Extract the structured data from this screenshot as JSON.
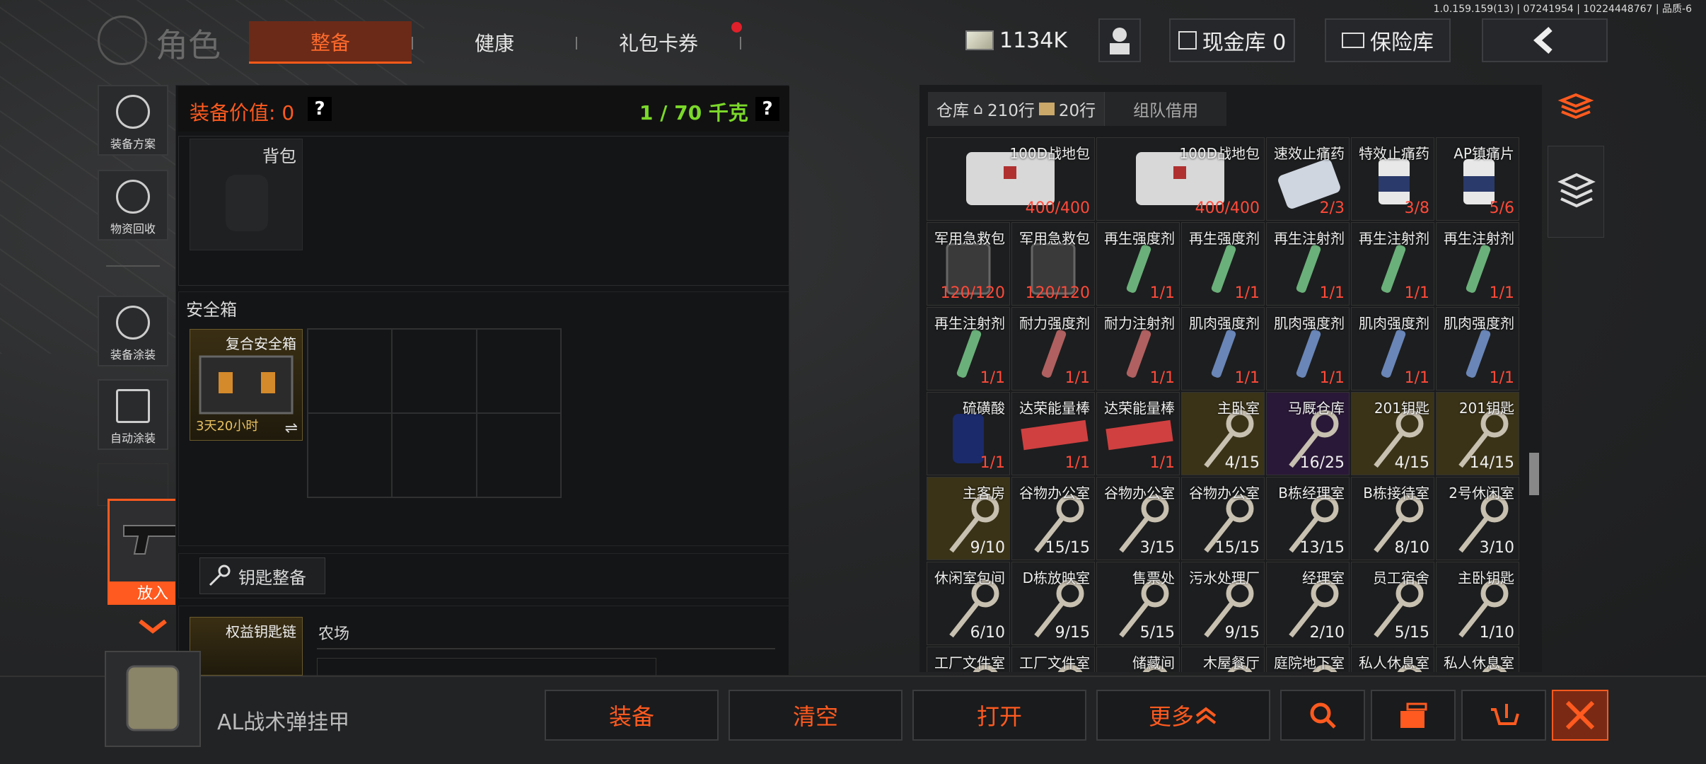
{
  "version": "1.0.159.159(13) | 07241954 | 10224448767 | 品质-6",
  "header": {
    "title": "角色",
    "tabs": [
      {
        "label": "整备",
        "active": true
      },
      {
        "label": "健康",
        "active": false
      },
      {
        "label": "礼包卡券",
        "active": false
      }
    ],
    "money": "1134K",
    "cash_vault": "现金库 0",
    "insurance": "保险库"
  },
  "sidebar": {
    "items": [
      {
        "label": "装备方案",
        "icon": "helmet-icon"
      },
      {
        "label": "物资回收",
        "icon": "recycle-icon"
      },
      {
        "label": "装备涂装",
        "icon": "paint-helmet-icon"
      },
      {
        "label": "自动涂装",
        "icon": "auto-paint-icon"
      }
    ],
    "drag_item_label": "放入"
  },
  "equip": {
    "value_label": "装备价值: 0",
    "weight": "1 / 70 千克",
    "help": "?",
    "backpack_label": "背包",
    "safebox_title": "安全箱",
    "safebox_item": "复合安全箱",
    "safebox_time": "3天20小时",
    "key_organize": "钥匙整备",
    "keychain_item": "权益钥匙链",
    "farm_label": "农场"
  },
  "storage": {
    "tab_warehouse": "仓库",
    "rows_home": "210行",
    "rows_bag": "20行",
    "tab_team": "组队借用",
    "rows": [
      [
        {
          "name": "100D战地包",
          "count": "400/400",
          "color": "dark",
          "kind": "bag"
        },
        {
          "name": "100D战地包",
          "count": "400/400",
          "color": "dark",
          "kind": "bag"
        },
        {
          "name": "速效止痛药",
          "count": "2/3",
          "color": "dark",
          "kind": "pills"
        },
        {
          "name": "特效止痛药",
          "count": "3/8",
          "color": "dark",
          "kind": "bottle"
        },
        {
          "name": "AP镇痛片",
          "count": "5/6",
          "color": "dark",
          "kind": "bottle"
        }
      ],
      [
        {
          "name": "军用急救包",
          "count": "120/120",
          "color": "dark",
          "kind": "kit"
        },
        {
          "name": "军用急救包",
          "count": "120/120",
          "color": "dark",
          "kind": "kit"
        },
        {
          "name": "再生强度剂",
          "count": "1/1",
          "color": "dark",
          "kind": "syr-g"
        },
        {
          "name": "再生强度剂",
          "count": "1/1",
          "color": "dark",
          "kind": "syr-g"
        },
        {
          "name": "再生注射剂",
          "count": "1/1",
          "color": "dark",
          "kind": "syr-g"
        },
        {
          "name": "再生注射剂",
          "count": "1/1",
          "color": "dark",
          "kind": "syr-g"
        },
        {
          "name": "再生注射剂",
          "count": "1/1",
          "color": "dark",
          "kind": "syr-g"
        }
      ],
      [
        {
          "name": "再生注射剂",
          "count": "1/1",
          "color": "dark",
          "kind": "syr-g"
        },
        {
          "name": "耐力强度剂",
          "count": "1/1",
          "color": "dark",
          "kind": "syr-r"
        },
        {
          "name": "耐力注射剂",
          "count": "1/1",
          "color": "dark",
          "kind": "syr-r"
        },
        {
          "name": "肌肉强度剂",
          "count": "1/1",
          "color": "dark",
          "kind": "syr-b"
        },
        {
          "name": "肌肉强度剂",
          "count": "1/1",
          "color": "dark",
          "kind": "syr-b"
        },
        {
          "name": "肌肉强度剂",
          "count": "1/1",
          "color": "dark",
          "kind": "syr-b"
        },
        {
          "name": "肌肉强度剂",
          "count": "1/1",
          "color": "dark",
          "kind": "syr-b"
        }
      ],
      [
        {
          "name": "硫磺酸",
          "count": "1/1",
          "color": "dark",
          "kind": "can"
        },
        {
          "name": "达荣能量棒",
          "count": "1/1",
          "color": "dark",
          "kind": "bar"
        },
        {
          "name": "达荣能量棒",
          "count": "1/1",
          "color": "dark",
          "kind": "bar"
        },
        {
          "name": "主卧室",
          "count": "4/15",
          "color": "gold",
          "kind": "key"
        },
        {
          "name": "马厩仓库",
          "count": "16/25",
          "color": "purple",
          "kind": "key"
        },
        {
          "name": "201钥匙",
          "count": "4/15",
          "color": "gold",
          "kind": "key"
        },
        {
          "name": "201钥匙",
          "count": "14/15",
          "color": "gold",
          "kind": "key"
        }
      ],
      [
        {
          "name": "主客房",
          "count": "9/10",
          "color": "gold",
          "kind": "key"
        },
        {
          "name": "谷物办公室",
          "count": "15/15",
          "color": "dark",
          "kind": "key"
        },
        {
          "name": "谷物办公室",
          "count": "3/15",
          "color": "dark",
          "kind": "key"
        },
        {
          "name": "谷物办公室",
          "count": "15/15",
          "color": "dark",
          "kind": "key"
        },
        {
          "name": "B栋经理室",
          "count": "13/15",
          "color": "dark",
          "kind": "key"
        },
        {
          "name": "B栋接待室",
          "count": "8/10",
          "color": "dark",
          "kind": "key"
        },
        {
          "name": "2号休闲室",
          "count": "3/10",
          "color": "dark",
          "kind": "key"
        }
      ],
      [
        {
          "name": "休闲室包间",
          "count": "6/10",
          "color": "dark",
          "kind": "key"
        },
        {
          "name": "D栋放映室",
          "count": "9/15",
          "color": "dark",
          "kind": "key"
        },
        {
          "name": "售票处",
          "count": "5/15",
          "color": "dark",
          "kind": "key"
        },
        {
          "name": "污水处理厂",
          "count": "9/15",
          "color": "dark",
          "kind": "key"
        },
        {
          "name": "经理室",
          "count": "2/10",
          "color": "dark",
          "kind": "key"
        },
        {
          "name": "员工宿舍",
          "count": "5/15",
          "color": "dark",
          "kind": "key"
        },
        {
          "name": "主卧钥匙",
          "count": "1/10",
          "color": "dark",
          "kind": "key"
        }
      ],
      [
        {
          "name": "工厂文件室",
          "count": "",
          "color": "dark",
          "kind": "key"
        },
        {
          "name": "工厂文件室",
          "count": "",
          "color": "dark",
          "kind": "key"
        },
        {
          "name": "储藏间",
          "count": "",
          "color": "dark",
          "kind": "key"
        },
        {
          "name": "木屋餐厅",
          "count": "",
          "color": "dark",
          "kind": "key"
        },
        {
          "name": "庭院地下室",
          "count": "",
          "color": "dark",
          "kind": "key"
        },
        {
          "name": "私人休息室",
          "count": "",
          "color": "dark",
          "kind": "key"
        },
        {
          "name": "私人休息室",
          "count": "",
          "color": "dark",
          "kind": "key"
        }
      ]
    ]
  },
  "bottom": {
    "selected_item": "AL战术弹挂甲",
    "btn_equip": "装备",
    "btn_clear": "清空",
    "btn_open": "打开",
    "btn_more": "更多",
    "icons": [
      "search-icon",
      "split-icon",
      "sell-icon",
      "close-icon"
    ]
  },
  "colors": {
    "accent": "#ff5a1f",
    "green": "#7bd82a",
    "count_red": "#ff4a3a"
  }
}
